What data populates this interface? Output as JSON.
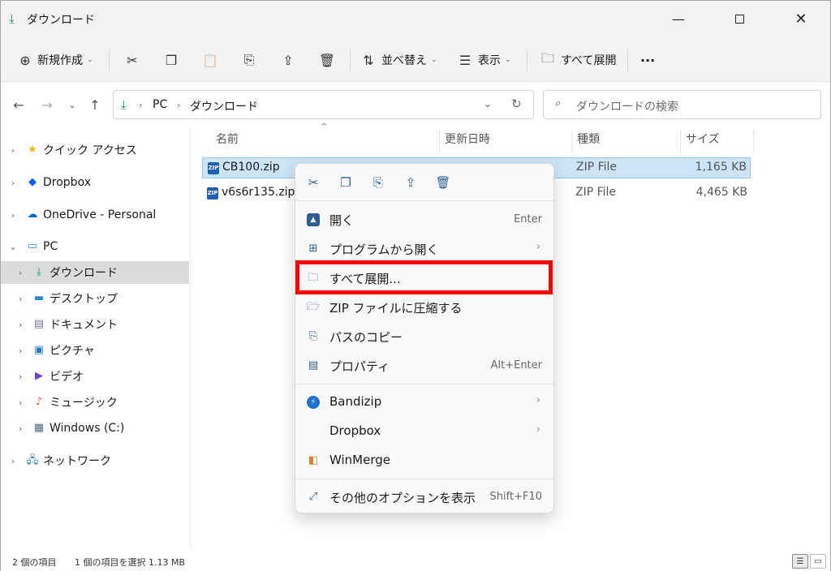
{
  "window": {
    "title": "ダウンロード",
    "minimize": "—",
    "close": "✕"
  },
  "toolbar": {
    "new_label": "新規作成",
    "sort_label": "並べ替え",
    "view_label": "表示",
    "extract_all_label": "すべて展開",
    "more_label": "···"
  },
  "address": {
    "pc": "PC",
    "folder": "ダウンロード",
    "search_placeholder": "ダウンロードの検索"
  },
  "nav_tree": {
    "quick_access": "クイック アクセス",
    "dropbox": "Dropbox",
    "onedrive": "OneDrive - Personal",
    "pc": "PC",
    "downloads": "ダウンロード",
    "desktop": "デスクトップ",
    "documents": "ドキュメント",
    "pictures": "ピクチャ",
    "videos": "ビデオ",
    "music": "ミュージック",
    "windows_c": "Windows (C:)",
    "network": "ネットワーク"
  },
  "columns": {
    "name": "名前",
    "modified": "更新日時",
    "type": "種類",
    "size": "サイズ"
  },
  "files": [
    {
      "name": "CB100.zip",
      "type": "ZIP File",
      "size": "1,165 KB"
    },
    {
      "name": "v6s6r135.zip",
      "type": "ZIP File",
      "size": "4,465 KB"
    }
  ],
  "status": {
    "item_count": "2 個の項目",
    "selected": "1 個の項目を選択 1.13 MB"
  },
  "context_menu": {
    "open": "開く",
    "open_shortcut": "Enter",
    "open_with": "プログラムから開く",
    "extract_all": "すべて展開...",
    "compress_zip": "ZIP ファイルに圧縮する",
    "copy_path": "パスのコピー",
    "properties": "プロパティ",
    "properties_shortcut": "Alt+Enter",
    "bandizip": "Bandizip",
    "dropbox": "Dropbox",
    "winmerge": "WinMerge",
    "more_options": "その他のオプションを表示",
    "more_options_shortcut": "Shift+F10"
  },
  "colors": {
    "selection": "#cce4f7",
    "highlight": "#ff0000",
    "download_green": "#1a8a5e"
  }
}
